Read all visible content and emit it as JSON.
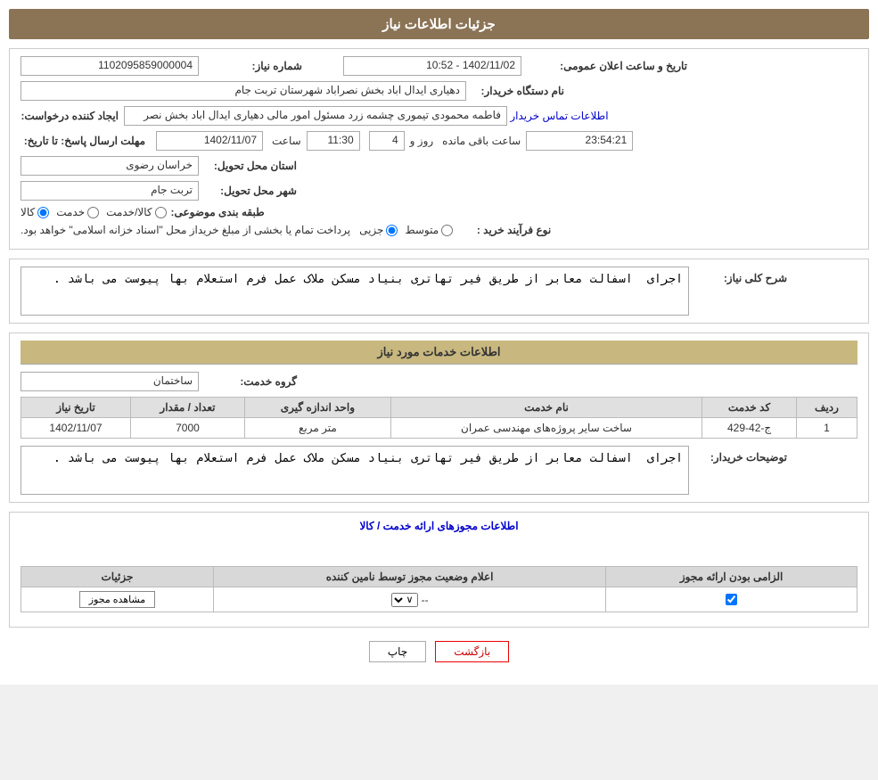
{
  "header": {
    "title": "جزئیات اطلاعات نیاز"
  },
  "generalInfo": {
    "shomareLabel": "شماره نیاز:",
    "shomareValue": "1102095859000004",
    "tarikhLabel": "تاریخ و ساعت اعلان عمومی:",
    "tarikhValue": "1402/11/02 - 10:52",
    "namdastgahLabel": "نام دستگاه خریدار:",
    "namdastgahValue": "دهیاری ایدال اباد بخش نصراباد شهرستان تربت جام",
    "ijadLabel": "ایجاد کننده درخواست:",
    "ijadValue": "فاطمه محمودی تیموری چشمه زرد مسئول امور مالی دهیاری ایدال اباد بخش نصر",
    "ijadLink": "اطلاعات تماس خریدار",
    "mohlat1Label": "مهلت ارسال پاسخ: تا تاریخ:",
    "tarikhMohlatValue": "1402/11/07",
    "saatLabel": "ساعت",
    "saatValue": "11:30",
    "rozLabel": "روز و",
    "rozValue": "4",
    "baghiLabel": "ساعت باقی مانده",
    "baghiValue": "23:54:21",
    "ostandLabel": "استان محل تحویل:",
    "ostandValue": "خراسان رضوی",
    "shahrLabel": "شهر محل تحویل:",
    "shahrValue": "تربت جام",
    "tabaqeLabel": "طبقه بندی موضوعی:",
    "tabaqeKala": "کالا",
    "tabaqeKhedmat": "خدمت",
    "tabaqeKalaKhedmat": "کالا/خدمت",
    "noeLabel": "نوع فرآیند خرید :",
    "noeJozyi": "جزیی",
    "noeMotavasset": "متوسط",
    "noeDesc": "پرداخت تمام یا بخشی از مبلغ خریداز محل \"اسناد خزانه اسلامی\" خواهد بود."
  },
  "sharhKoli": {
    "label": "شرح کلی نیاز:",
    "value": "اجرای  اسفالت معابر از طریق فیر تهاتری بنیاد مسکن ملاک عمل فرم استعلام بها پیوست می باشد ."
  },
  "khadamatSection": {
    "title": "اطلاعات خدمات مورد نیاز",
    "groupLabel": "گروه خدمت:",
    "groupValue": "ساختمان",
    "tableHeaders": [
      "ردیف",
      "کد خدمت",
      "نام خدمت",
      "واحد اندازه گیری",
      "تعداد / مقدار",
      "تاریخ نیاز"
    ],
    "tableRows": [
      {
        "radif": "1",
        "kodKhedmat": "ج-42-429",
        "namKhedmat": "ساخت سایر پروژه‌های مهندسی عمران",
        "vahed": "متر مربع",
        "tedad": "7000",
        "tarikh": "1402/11/07"
      }
    ]
  },
  "toseyhKharidar": {
    "label": "توضیحات خریدار:",
    "value": "اجرای  اسفالت معابر از طریق فیر تهاتری بنیاد مسکن ملاک عمل فرم استعلام بها پیوست می باشد ."
  },
  "mojouzSection": {
    "linkTitle": "اطلاعات مجوزهای ارائه خدمت / کالا",
    "tableHeaders": [
      "الزامی بودن ارائه مجوز",
      "اعلام وضعیت مجوز توسط نامین کننده",
      "جزئیات"
    ],
    "tableRows": [
      {
        "elzami": true,
        "aelam": "--",
        "details": "مشاهده مجوز"
      }
    ]
  },
  "buttons": {
    "print": "چاپ",
    "back": "بازگشت"
  }
}
